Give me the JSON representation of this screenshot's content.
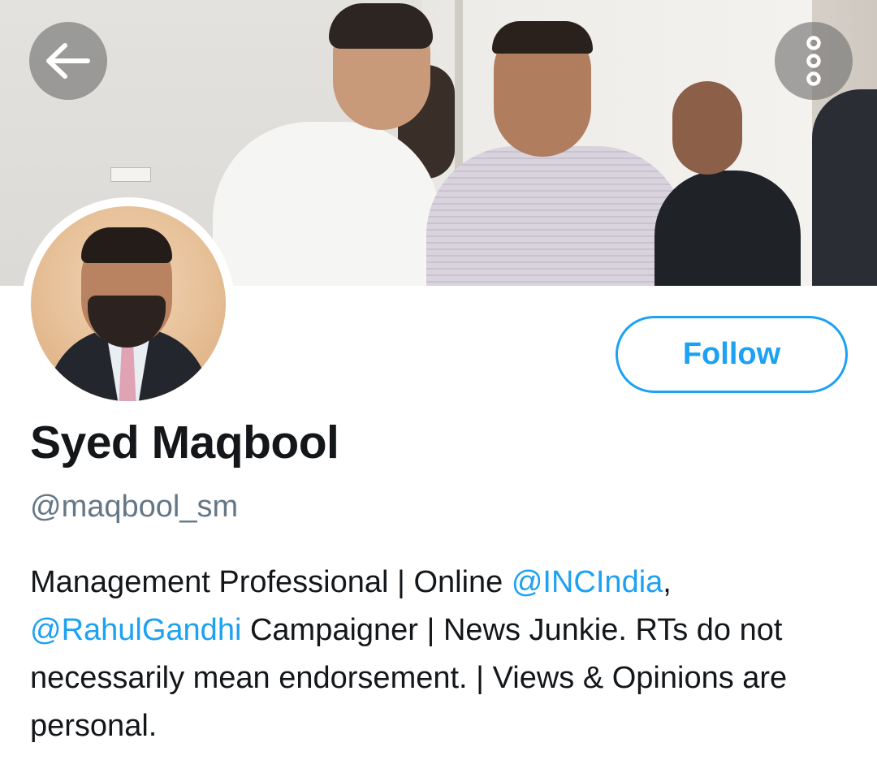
{
  "header": {
    "back_icon": "arrow-left-icon",
    "more_icon": "vertical-ellipsis-icon"
  },
  "profile": {
    "display_name": "Syed Maqbool",
    "handle": "@maqbool_sm",
    "follow_label": "Follow",
    "bio": {
      "part1": "Management Professional | Online ",
      "mention1": "@INCIndia",
      "part2": ",",
      "mention2": "@RahulGandhi",
      "part3": " Campaigner | News Junkie. RTs do not necessarily mean endorsement. | Views & Opinions are personal."
    }
  },
  "colors": {
    "accent": "#1da1f2",
    "text_primary": "#14171a",
    "text_secondary": "#657786",
    "overlay_button": "#6e6e6e"
  }
}
